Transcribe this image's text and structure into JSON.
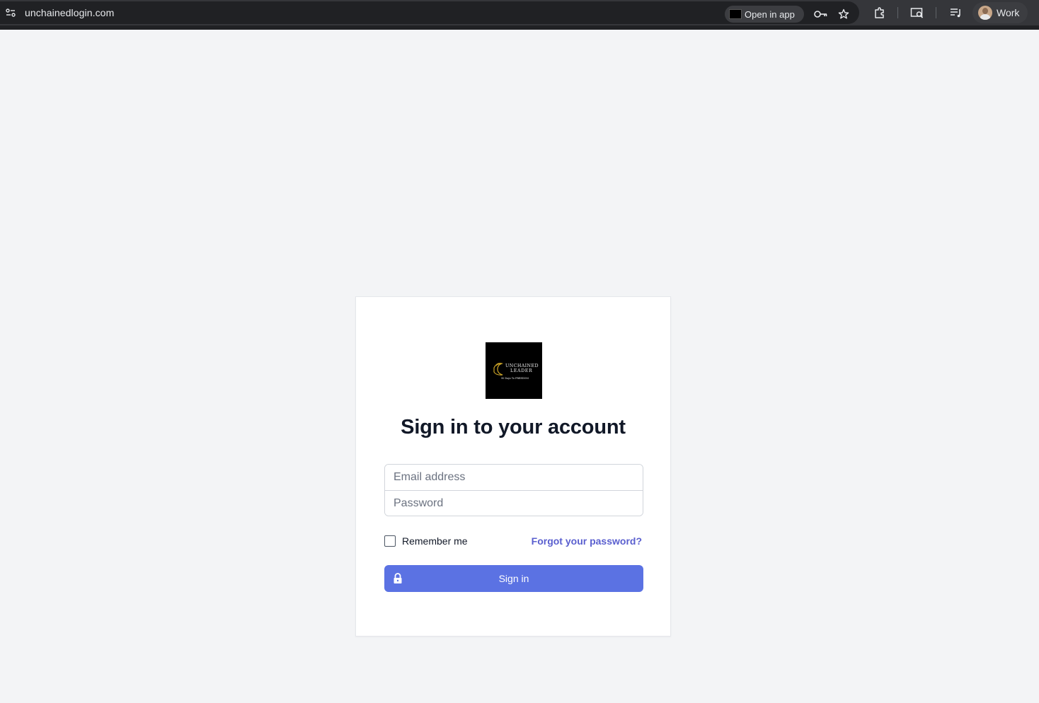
{
  "browser": {
    "url": "unchainedlogin.com",
    "open_in_app_label": "Open in app",
    "profile_label": "Work",
    "icons": [
      "site-settings-icon",
      "password-key-icon",
      "bookmark-star-icon",
      "extensions-icon",
      "screen-search-icon",
      "media-control-icon"
    ]
  },
  "login": {
    "logo": {
      "line1": "UNCHAINED",
      "line2": "LEADER",
      "tagline": "90 Days To FREEDOM",
      "accent_color": "#c9a227"
    },
    "title": "Sign in to your account",
    "email_placeholder": "Email address",
    "password_placeholder": "Password",
    "remember_label": "Remember me",
    "forgot_label": "Forgot your password?",
    "signin_label": "Sign in"
  },
  "colors": {
    "page_bg": "#f3f4f6",
    "primary": "#5b72e3",
    "link": "#5a5fcf",
    "heading": "#111827"
  }
}
